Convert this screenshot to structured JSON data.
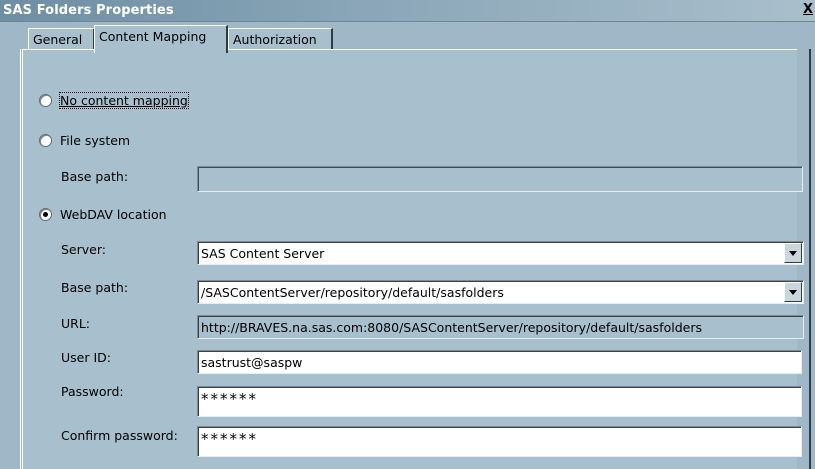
{
  "window": {
    "title": "SAS Folders Properties",
    "close_label": "X"
  },
  "tabs": [
    {
      "label": "General",
      "active": false
    },
    {
      "label": "Content Mapping",
      "active": true
    },
    {
      "label": "Authorization",
      "active": false
    }
  ],
  "options": {
    "no_mapping": {
      "label": "No content mapping",
      "checked": false
    },
    "file_system": {
      "label": "File system",
      "checked": false
    },
    "webdav": {
      "label": "WebDAV location",
      "checked": true
    }
  },
  "file_system": {
    "base_path_label": "Base path:",
    "base_path_value": ""
  },
  "webdav": {
    "server_label": "Server:",
    "server_value": "SAS Content Server",
    "base_path_label": "Base path:",
    "base_path_value": "/SASContentServer/repository/default/sasfolders",
    "url_label": "URL:",
    "url_value": "http://BRAVES.na.sas.com:8080/SASContentServer/repository/default/sasfolders",
    "user_id_label": "User ID:",
    "user_id_value": "sastrust@saspw",
    "password_label": "Password:",
    "password_value": "******",
    "confirm_password_label": "Confirm password:",
    "confirm_password_value": "******"
  },
  "colors": {
    "background": "#9fb7c6",
    "panel": "#a8bfcd",
    "title_text": "#ffffff"
  },
  "icons": {
    "close": "close-icon",
    "dropdown": "chevron-down-icon"
  }
}
